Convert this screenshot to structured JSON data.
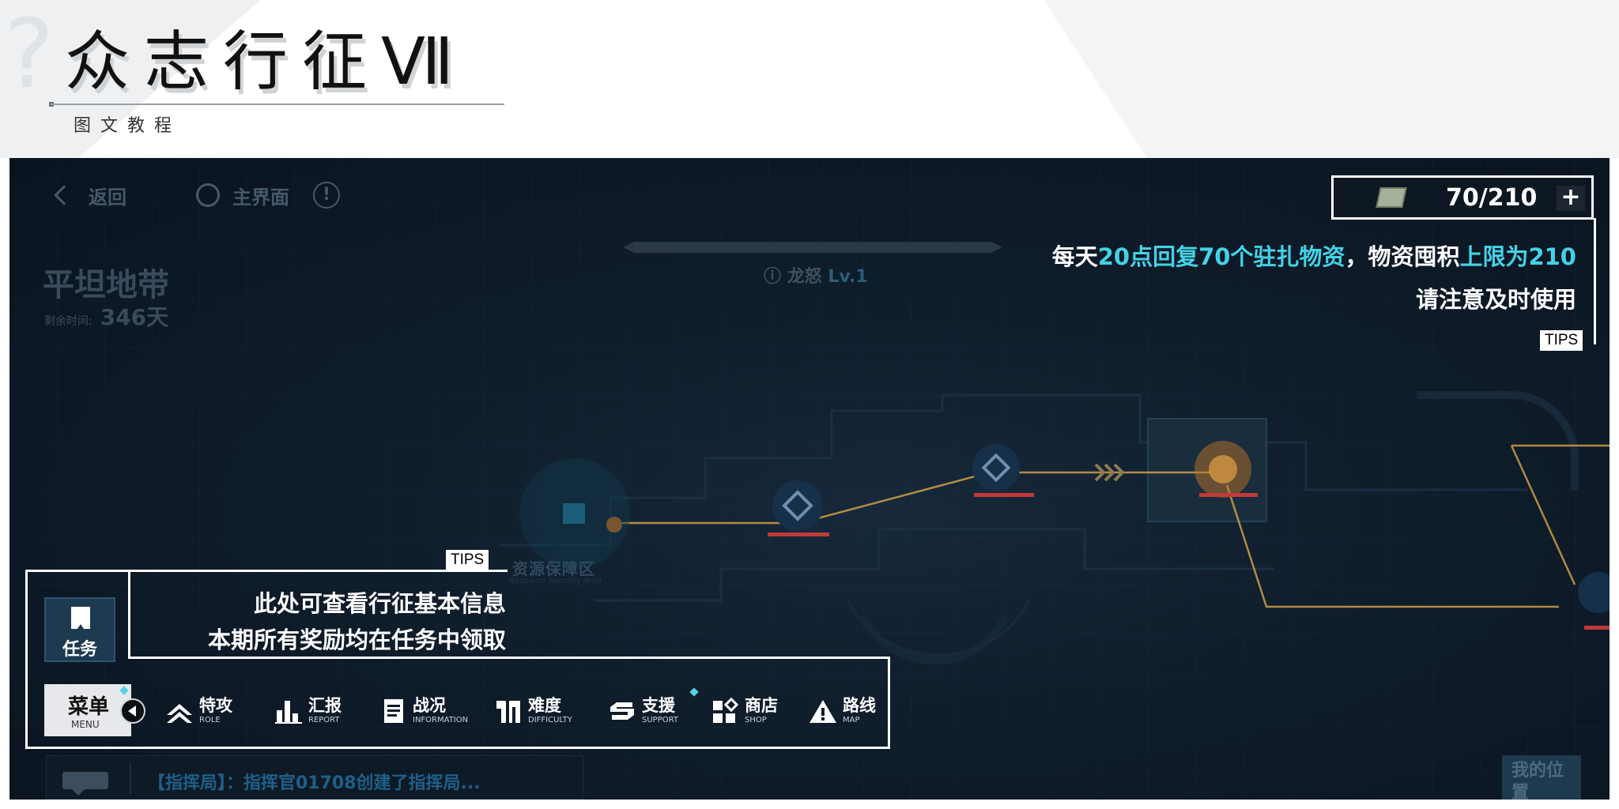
{
  "header": {
    "title": "众志行征Ⅶ",
    "subtitle": "图文教程"
  },
  "game": {
    "nav": {
      "back_label": "返回",
      "home_label": "主界面",
      "info_icon": "!"
    },
    "area": {
      "name": "平坦地带",
      "remain_label": "剩余时间:",
      "remain_value": "346天"
    },
    "boss": {
      "name": "龙怒",
      "level": "Lv.1"
    },
    "resource": {
      "icon": "supply-crate-icon",
      "value": "70/210",
      "plus": "+"
    },
    "map": {
      "zone_name": "资源保障区",
      "zone_sub": "Resource Security Area",
      "my_location": "我的位置"
    },
    "chat": {
      "message": "【指挥局】：指挥官01708创建了指挥局..."
    },
    "task": {
      "label": "任务"
    },
    "menu": {
      "menu_zh": "菜单",
      "menu_en": "MENU",
      "items": [
        {
          "zh": "特攻",
          "en": "ROLE",
          "icon": "role-chevron-icon"
        },
        {
          "zh": "汇报",
          "en": "REPORT",
          "icon": "report-bars-icon"
        },
        {
          "zh": "战况",
          "en": "INFORMATION",
          "icon": "information-doc-icon"
        },
        {
          "zh": "难度",
          "en": "DIFFICULTY",
          "icon": "difficulty-icon"
        },
        {
          "zh": "支援",
          "en": "SUPPORT",
          "icon": "support-s-icon"
        },
        {
          "zh": "商店",
          "en": "SHOP",
          "icon": "shop-grid-icon"
        },
        {
          "zh": "路线",
          "en": "MAP",
          "icon": "map-warning-icon"
        }
      ]
    }
  },
  "tips": {
    "tag": "TIPS",
    "resource_tip": {
      "p1": "每天",
      "h1": "20点回复70个驻扎物资",
      "p2": "，物资囤积",
      "h2": "上限为210",
      "line2": "请注意及时使用"
    },
    "task_tip": {
      "line1": "此处可查看行征基本信息",
      "line2": "本期所有奖励均在任务中领取"
    }
  },
  "colors": {
    "highlight": "#44d2e6",
    "route": "#d8a64a",
    "node_marker": "#c03a3a",
    "background": "#0f1c2a"
  }
}
